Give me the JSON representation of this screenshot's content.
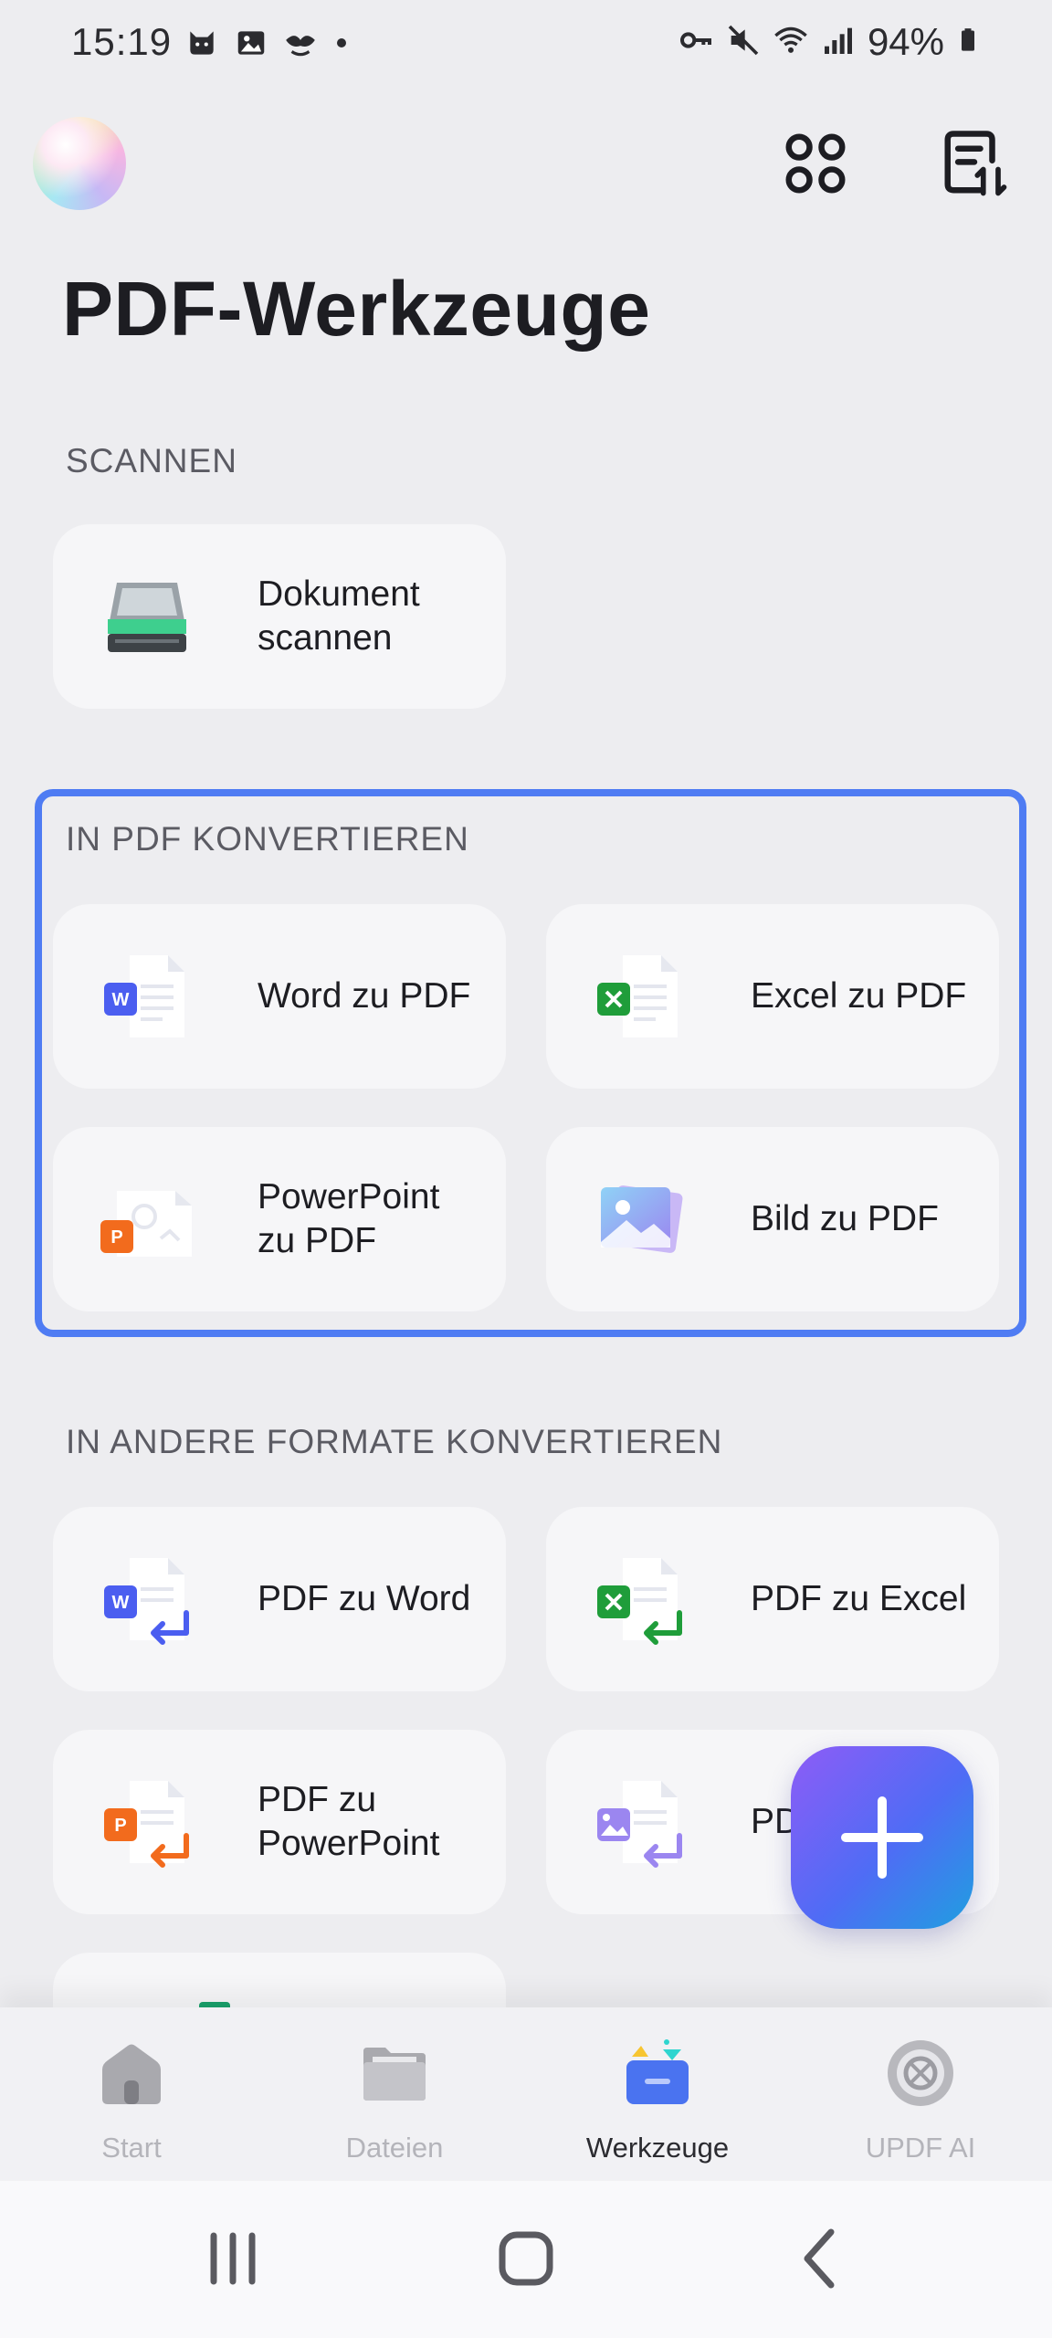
{
  "status_bar": {
    "time": "15:19",
    "battery": "94%"
  },
  "header": {
    "title": "PDF-Werkzeuge"
  },
  "sections": {
    "scan": {
      "label": "SCANNEN",
      "items": [
        {
          "label": "Dokument scannen",
          "icon": "scanner-icon"
        }
      ]
    },
    "to_pdf": {
      "label": "IN PDF KONVERTIEREN",
      "items": [
        {
          "label": "Word zu PDF",
          "icon": "word-file-icon"
        },
        {
          "label": "Excel zu PDF",
          "icon": "excel-file-icon"
        },
        {
          "label": "PowerPoint zu PDF",
          "icon": "powerpoint-file-icon"
        },
        {
          "label": "Bild zu PDF",
          "icon": "image-file-icon"
        }
      ]
    },
    "from_pdf": {
      "label": "IN ANDERE FORMATE KONVERTIEREN",
      "items": [
        {
          "label": "PDF zu Word",
          "icon": "pdf-to-word-icon"
        },
        {
          "label": "PDF zu Excel",
          "icon": "pdf-to-excel-icon"
        },
        {
          "label": "PDF zu PowerPoint",
          "icon": "pdf-to-powerpoint-icon"
        },
        {
          "label": "PDF",
          "icon": "pdf-to-image-icon"
        }
      ]
    }
  },
  "bottom_nav": {
    "items": [
      {
        "label": "Start",
        "icon": "home-icon",
        "active": false
      },
      {
        "label": "Dateien",
        "icon": "folder-icon",
        "active": false
      },
      {
        "label": "Werkzeuge",
        "icon": "toolbox-icon",
        "active": true
      },
      {
        "label": "UPDF AI",
        "icon": "ai-icon",
        "active": false
      }
    ]
  },
  "colors": {
    "highlight": "#4f7cf3",
    "background": "#ededf0",
    "card": "#f6f6f8",
    "word": "#4b5ef0",
    "excel": "#1f9d3a",
    "powerpoint": "#f26b1d"
  }
}
